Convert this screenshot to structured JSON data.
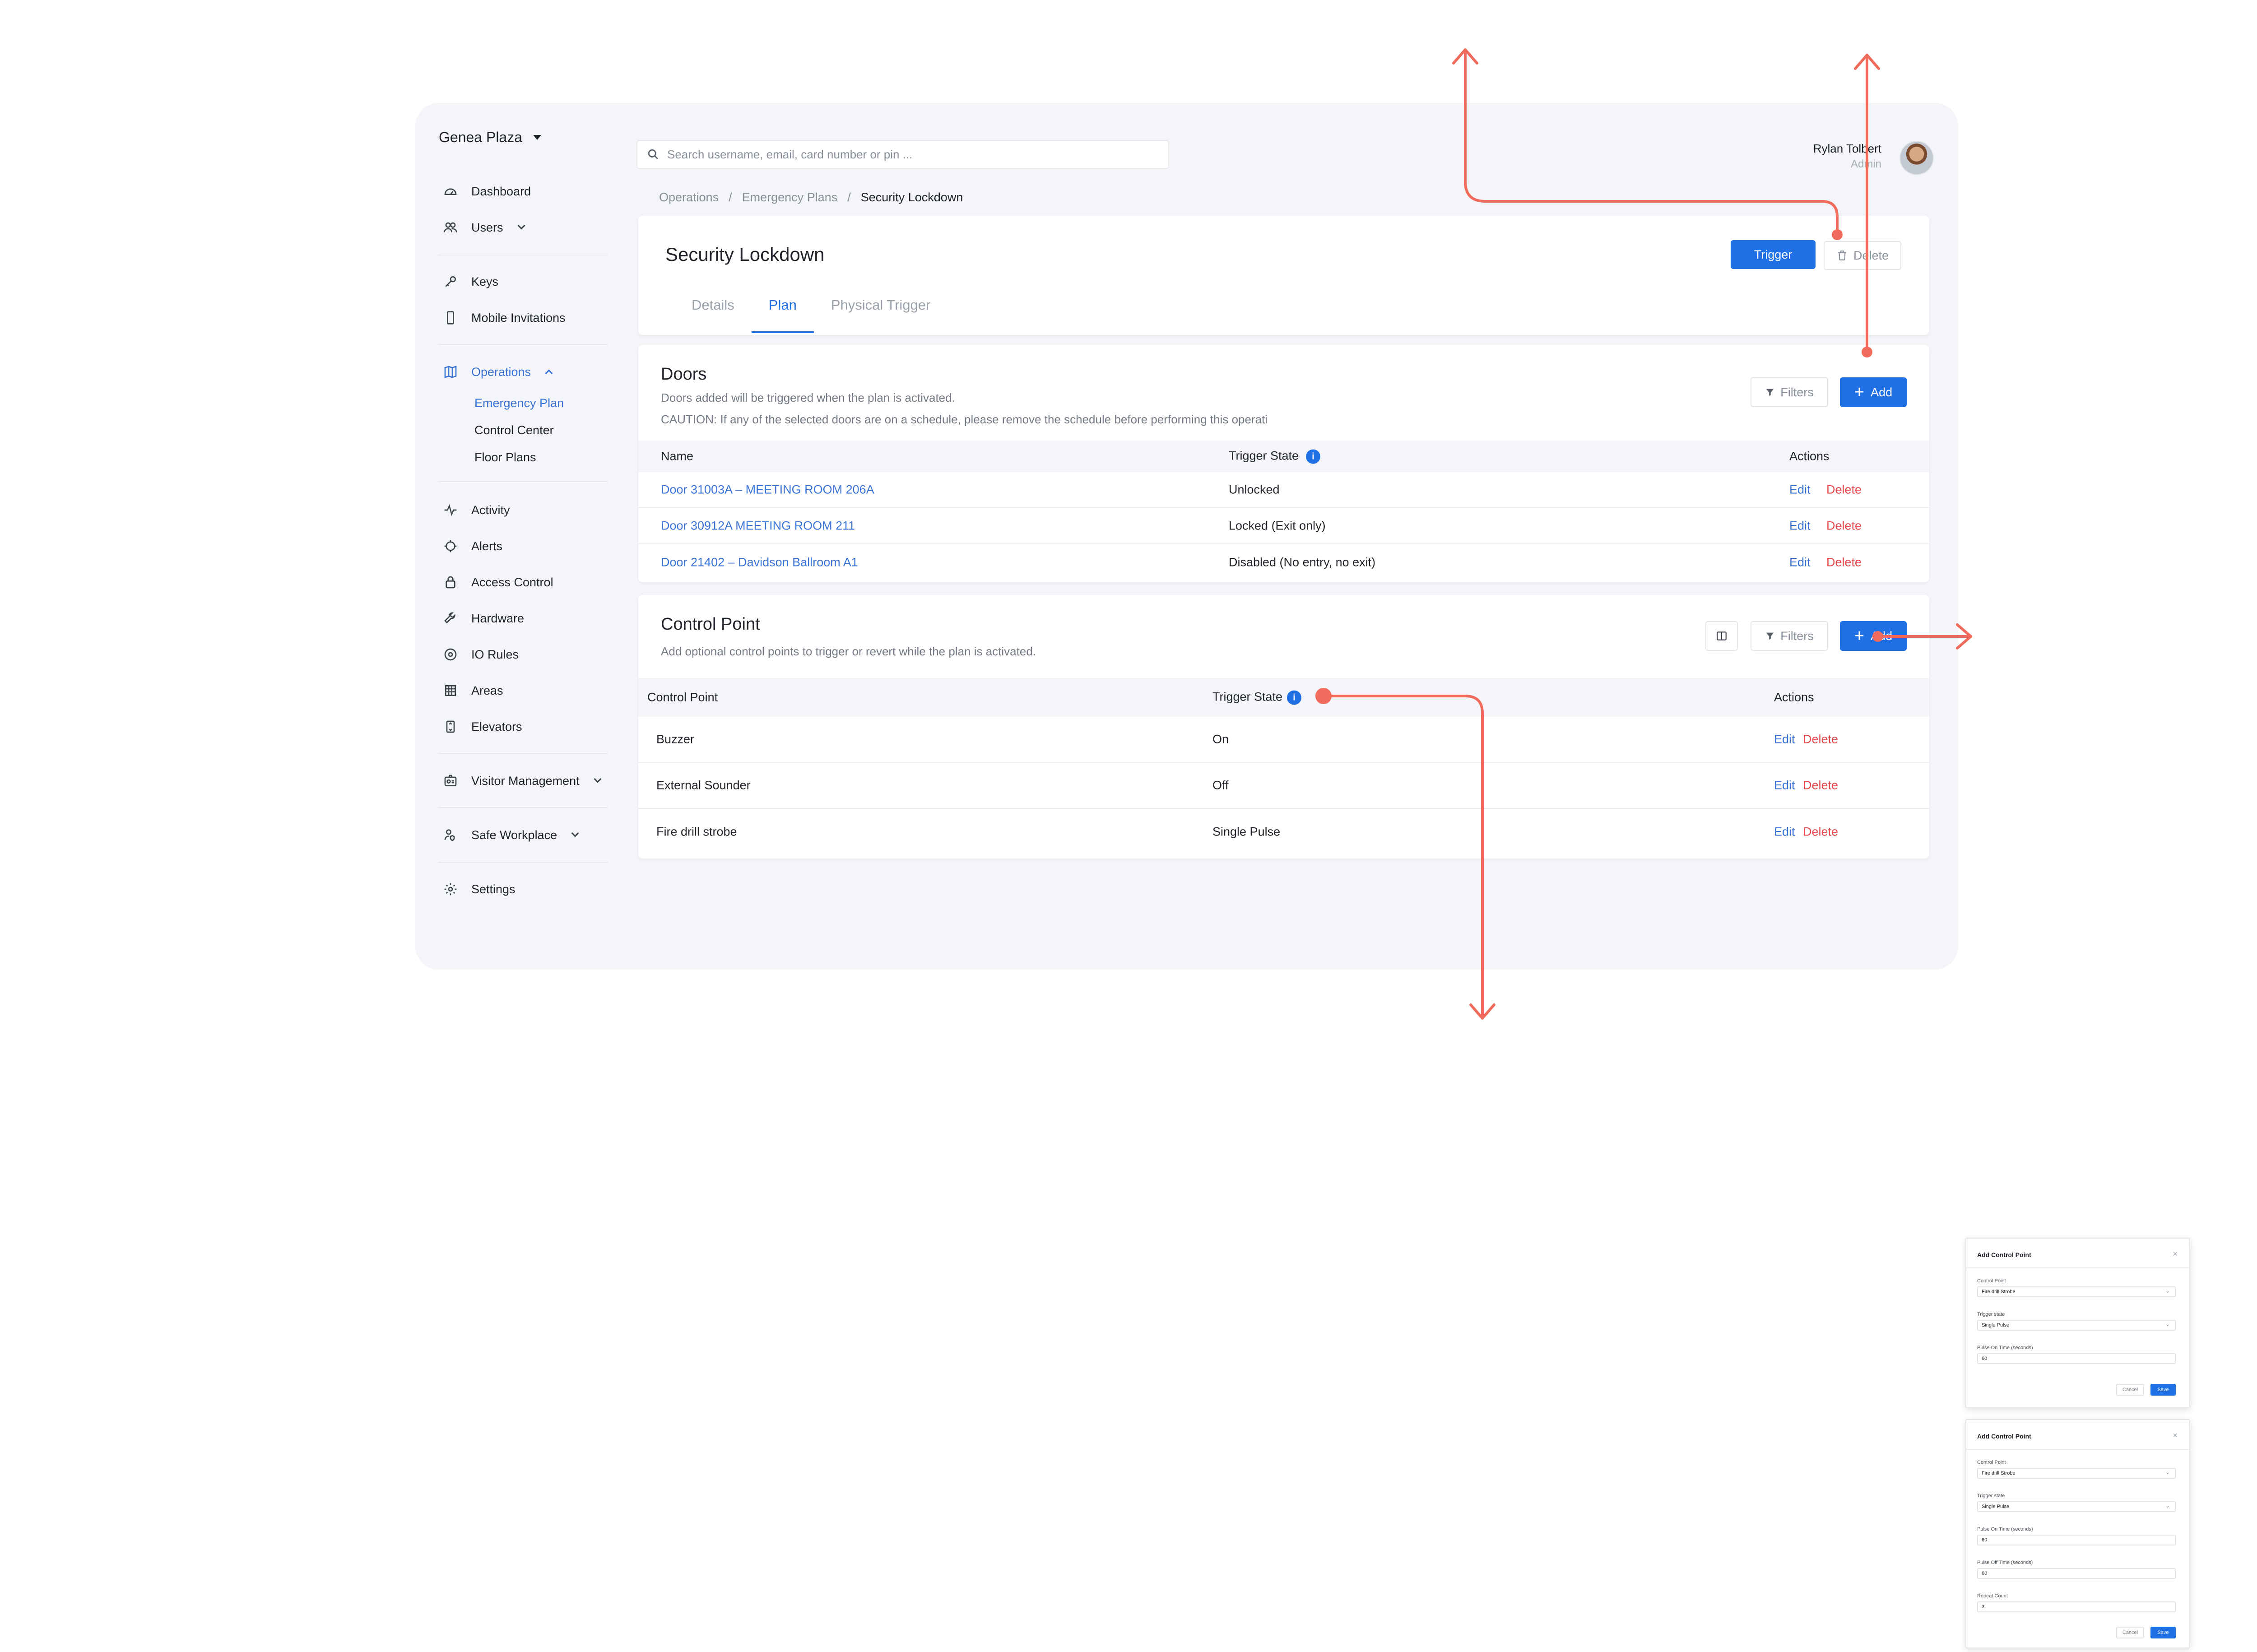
{
  "org": {
    "name": "Genea Plaza"
  },
  "nav": {
    "dashboard": "Dashboard",
    "users": "Users",
    "keys": "Keys",
    "mobile_invitations": "Mobile Invitations",
    "operations": "Operations",
    "operations_sub": [
      "Emergency Plan",
      "Control Center",
      "Floor Plans"
    ],
    "activity": "Activity",
    "alerts": "Alerts",
    "access_control": "Access Control",
    "hardware": "Hardware",
    "io_rules": "IO Rules",
    "areas": "Areas",
    "elevators": "Elevators",
    "visitor_management": "Visitor Management",
    "safe_workplace": "Safe Workplace",
    "settings": "Settings"
  },
  "search": {
    "placeholder": "Search username, email, card number or pin ..."
  },
  "user": {
    "name": "Rylan Tolbert",
    "role": "Admin"
  },
  "breadcrumb": [
    "Operations",
    "Emergency Plans",
    "Security Lockdown"
  ],
  "breadcrumb_sep": "/",
  "page": {
    "title": "Security Lockdown",
    "trigger_label": "Trigger",
    "delete_label": "Delete",
    "tabs": [
      "Details",
      "Plan",
      "Physical Trigger"
    ],
    "active_tab": "Plan"
  },
  "doors": {
    "title": "Doors",
    "desc1": "Doors added will be triggered when the plan is activated.",
    "desc2": "CAUTION: If any of the selected doors are on a schedule, please remove the schedule before performing this operati",
    "filters_label": "Filters",
    "add_label": "Add",
    "columns": [
      "Name",
      "Trigger State",
      "Actions"
    ],
    "rows": [
      {
        "name": "Door 31003A – MEETING ROOM 206A",
        "state": "Unlocked"
      },
      {
        "name": "Door 30912A MEETING ROOM 211",
        "state": "Locked (Exit only)"
      },
      {
        "name": "Door 21402 – Davidson Ballroom A1",
        "state": "Disabled (No entry, no exit)"
      }
    ],
    "edit_label": "Edit",
    "delete_label": "Delete"
  },
  "control_points": {
    "title": "Control Point",
    "desc": "Add optional control points to trigger or revert while the plan is activated.",
    "filters_label": "Filters",
    "add_label": "Add",
    "columns": [
      "Control Point",
      "Trigger State",
      "Actions"
    ],
    "rows": [
      {
        "name": "Buzzer",
        "state": "On"
      },
      {
        "name": "External Sounder",
        "state": "Off"
      },
      {
        "name": "Fire drill strobe",
        "state": "Single Pulse"
      }
    ],
    "edit_label": "Edit",
    "delete_label": "Delete"
  },
  "modal_a": {
    "title": "Add Control Point",
    "control_point_label": "Control Point",
    "control_point_value": "Fire drill Strobe",
    "trigger_state_label": "Trigger state",
    "trigger_state_value": "Single Pulse",
    "pulse_on_label": "Pulse On Time (seconds)",
    "pulse_on_value": "60",
    "cancel_label": "Cancel",
    "save_label": "Save"
  },
  "modal_b": {
    "title": "Add Control Point",
    "control_point_label": "Control Point",
    "control_point_value": "Fire drill Strobe",
    "trigger_state_label": "Trigger state",
    "trigger_state_value": "Single Pulse",
    "pulse_on_label": "Pulse On Time (seconds)",
    "pulse_on_value": "60",
    "pulse_off_label": "Pulse Off Time (seconds)",
    "pulse_off_value": "60",
    "repeat_label": "Repeat Count",
    "repeat_value": "3",
    "cancel_label": "Cancel",
    "save_label": "Save"
  },
  "colors": {
    "primary": "#1f6fe5",
    "danger": "#e5484d",
    "annotation": "#f06b5c",
    "link": "#3a73d6"
  }
}
